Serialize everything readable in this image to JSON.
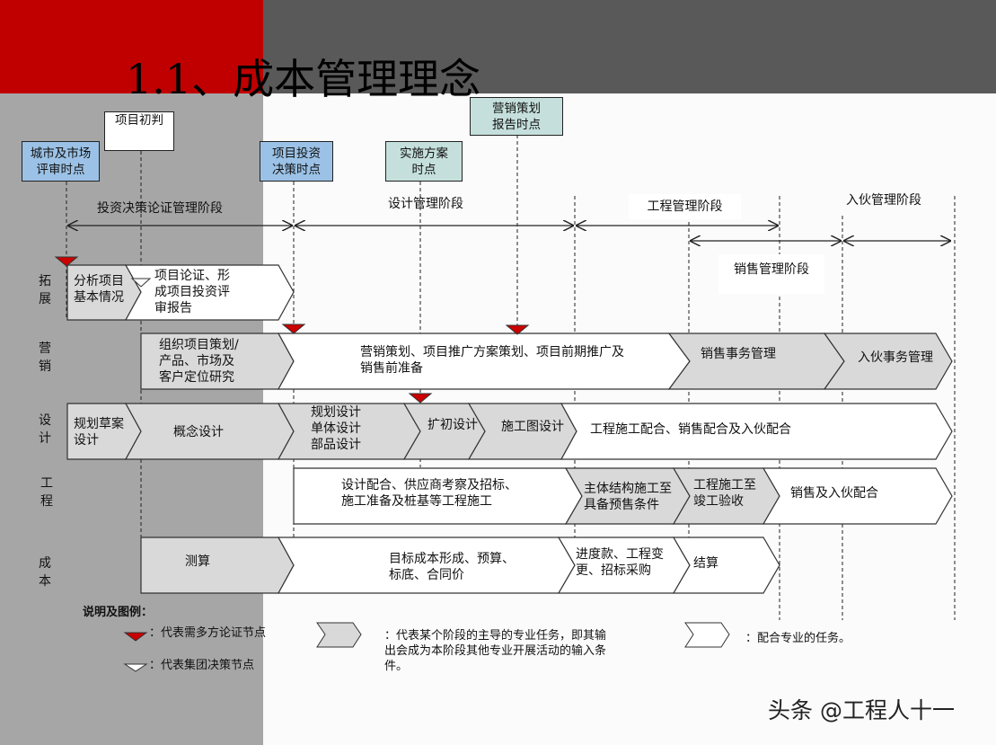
{
  "title": "1.1、成本管理理念",
  "milestones": {
    "city_market": "城市及市场\n评审时点",
    "project_initial": "项目初判",
    "investment_decision": "项目投资\n决策时点",
    "implementation_plan": "实施方案\n时点",
    "marketing_report": "营销策划\n报告时点"
  },
  "phases": {
    "investment": "投资决策论证管理阶段",
    "design": "设计管理阶段",
    "engineering": "工程管理阶段",
    "move_in": "入伙管理阶段",
    "sales": "销售管理阶段"
  },
  "rows": {
    "expansion": "拓\n展",
    "marketing": "营\n销",
    "design": "设\n计",
    "engineering": "工\n程",
    "cost": "成\n本"
  },
  "tasks": {
    "analyze_project": "分析项目\n基本情况",
    "project_demonstration": "项目论证、形\n成项目投资评\n审报告",
    "org_planning": "组织项目策划/\n产品、市场及\n客户定位研究",
    "marketing_planning": "营销策划、项目推广方案策划、项目前期推广及\n销售前准备",
    "sales_affairs": "销售事务管理",
    "move_in_affairs": "入伙事务管理",
    "planning_draft": "规划草案\n设计",
    "concept_design": "概念设计",
    "planning_unit": "规划设计\n单体设计\n部品设计",
    "preliminary": "扩初设计",
    "construction_drawing": "施工图设计",
    "construction_coop": "工程施工配合、销售配合及入伙配合",
    "design_coop": "设计配合、供应商考察及招标、\n施工准备及桩基等工程施工",
    "main_structure": "主体结构施工至\n具备预售条件",
    "completion": "工程施工至\n竣工验收",
    "sales_move_coop": "销售及入伙配合",
    "estimate": "测算",
    "target_cost": "目标成本形成、预算、\n标底、合同价",
    "progress_payment": "进度款、工程变\n更、招标采购",
    "settlement": "结算"
  },
  "legend": {
    "title": "说明及图例：",
    "red_node": "：代表需多方论证节点",
    "white_node": "：代表集团决策节点",
    "lead_task": "：代表某个阶段的主导的专业任务，即其输\n出会成为本阶段其他专业开展活动的输入条\n件。",
    "support_task": "：配合专业的任务。"
  },
  "watermark": "头条 @工程人十一",
  "colors": {
    "header_red": "#c00000",
    "header_dark": "#595959",
    "left_gray": "#a6a6a6",
    "lead_fill": "#d9d9d9",
    "milestone_blue": "#9bc2e6",
    "milestone_teal": "#c5e0dc",
    "marker_red": "#cc0000"
  }
}
